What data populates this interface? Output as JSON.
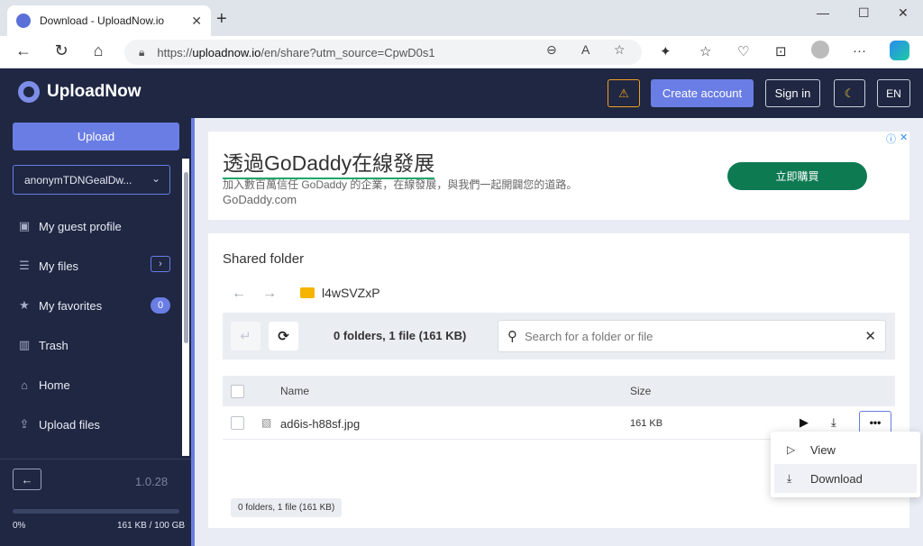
{
  "browser": {
    "tab_title": "Download - UploadNow.io",
    "tab_close": "✕",
    "new_tab": "+",
    "url_prefix": "https://",
    "url_domain": "uploadnow.io",
    "url_path": "/en/share?utm_source=CpwD0s1"
  },
  "header": {
    "brand": "UploadNow",
    "warning_icon": "⚠",
    "create_account": "Create account",
    "sign_in": "Sign in",
    "theme_icon": "☾",
    "language": "EN"
  },
  "sidebar": {
    "upload": "Upload",
    "account": "anonymTDNGealDw...",
    "items": [
      {
        "label": "My guest profile",
        "icon": "user-icon"
      },
      {
        "label": "My files",
        "icon": "files-icon"
      },
      {
        "label": "My favorites",
        "icon": "star-icon"
      },
      {
        "label": "Trash",
        "icon": "trash-icon"
      },
      {
        "label": "Home",
        "icon": "home-icon"
      },
      {
        "label": "Upload files",
        "icon": "upload-icon"
      }
    ],
    "favorites_count": "0",
    "version": "1.0.28",
    "quota_percent": "0%",
    "quota_fill": 0,
    "quota_usage": "161 KB / 100 GB"
  },
  "ad": {
    "headline": "透過GoDaddy在線發展",
    "body": "加入數百萬信任 GoDaddy 的企業，在線發展，與我們一起開闢您的道路。",
    "domain": "GoDaddy.com",
    "cta": "立即購買",
    "info_icon": "ⓘ",
    "close_icon": "✕"
  },
  "panel": {
    "title": "Shared folder",
    "folder_name": "l4wSVZxP",
    "summary": "0 folders, 1 file (161 KB)",
    "search_placeholder": "Search for a folder or file",
    "columns": {
      "name": "Name",
      "size": "Size"
    },
    "files": [
      {
        "name": "ad6is-h88sf.jpg",
        "size": "161 KB"
      }
    ],
    "footer_count": "0 folders, 1 file (161 KB)"
  },
  "context_menu": {
    "items": [
      {
        "label": "View",
        "icon": "play-outline-icon"
      },
      {
        "label": "Download",
        "icon": "download-tray-icon"
      }
    ]
  },
  "colors": {
    "accent": "#6a7de4",
    "navy": "#1f2742",
    "ad_green": "#0e7a52",
    "warning": "#f0a020"
  }
}
